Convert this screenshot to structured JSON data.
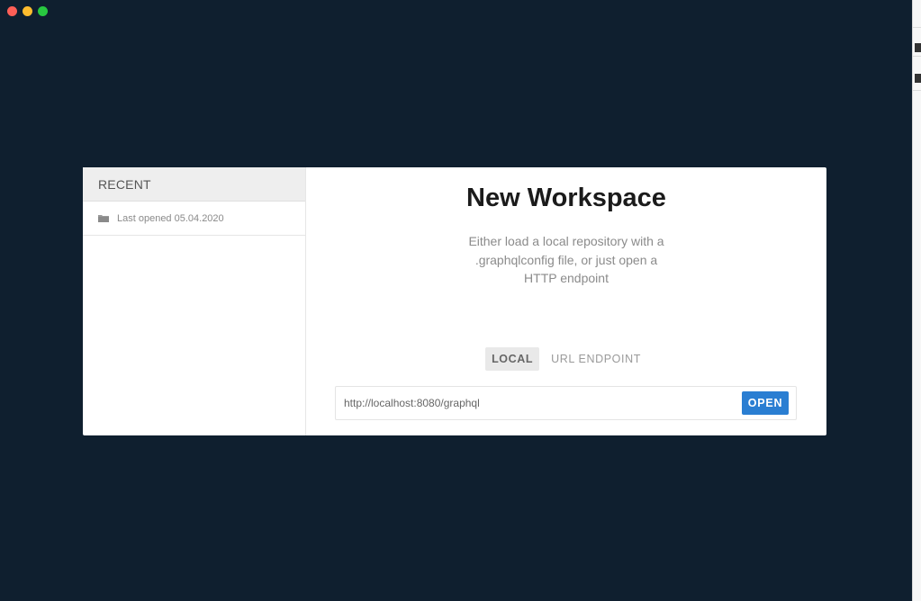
{
  "sidebar": {
    "header": "RECENT",
    "items": [
      {
        "label": "Last opened 05.04.2020",
        "icon": "folder-icon"
      }
    ]
  },
  "main": {
    "title": "New Workspace",
    "description": "Either load a local repository with a .graphqlconfig file, or just open a HTTP endpoint",
    "tabs": [
      {
        "label": "LOCAL",
        "active": true
      },
      {
        "label": "URL ENDPOINT",
        "active": false
      }
    ],
    "endpoint": {
      "value": "http://localhost:8080/graphql",
      "placeholder": "",
      "button_label": "OPEN"
    }
  },
  "colors": {
    "background": "#0f1f2f",
    "accent": "#2a7ed2"
  }
}
